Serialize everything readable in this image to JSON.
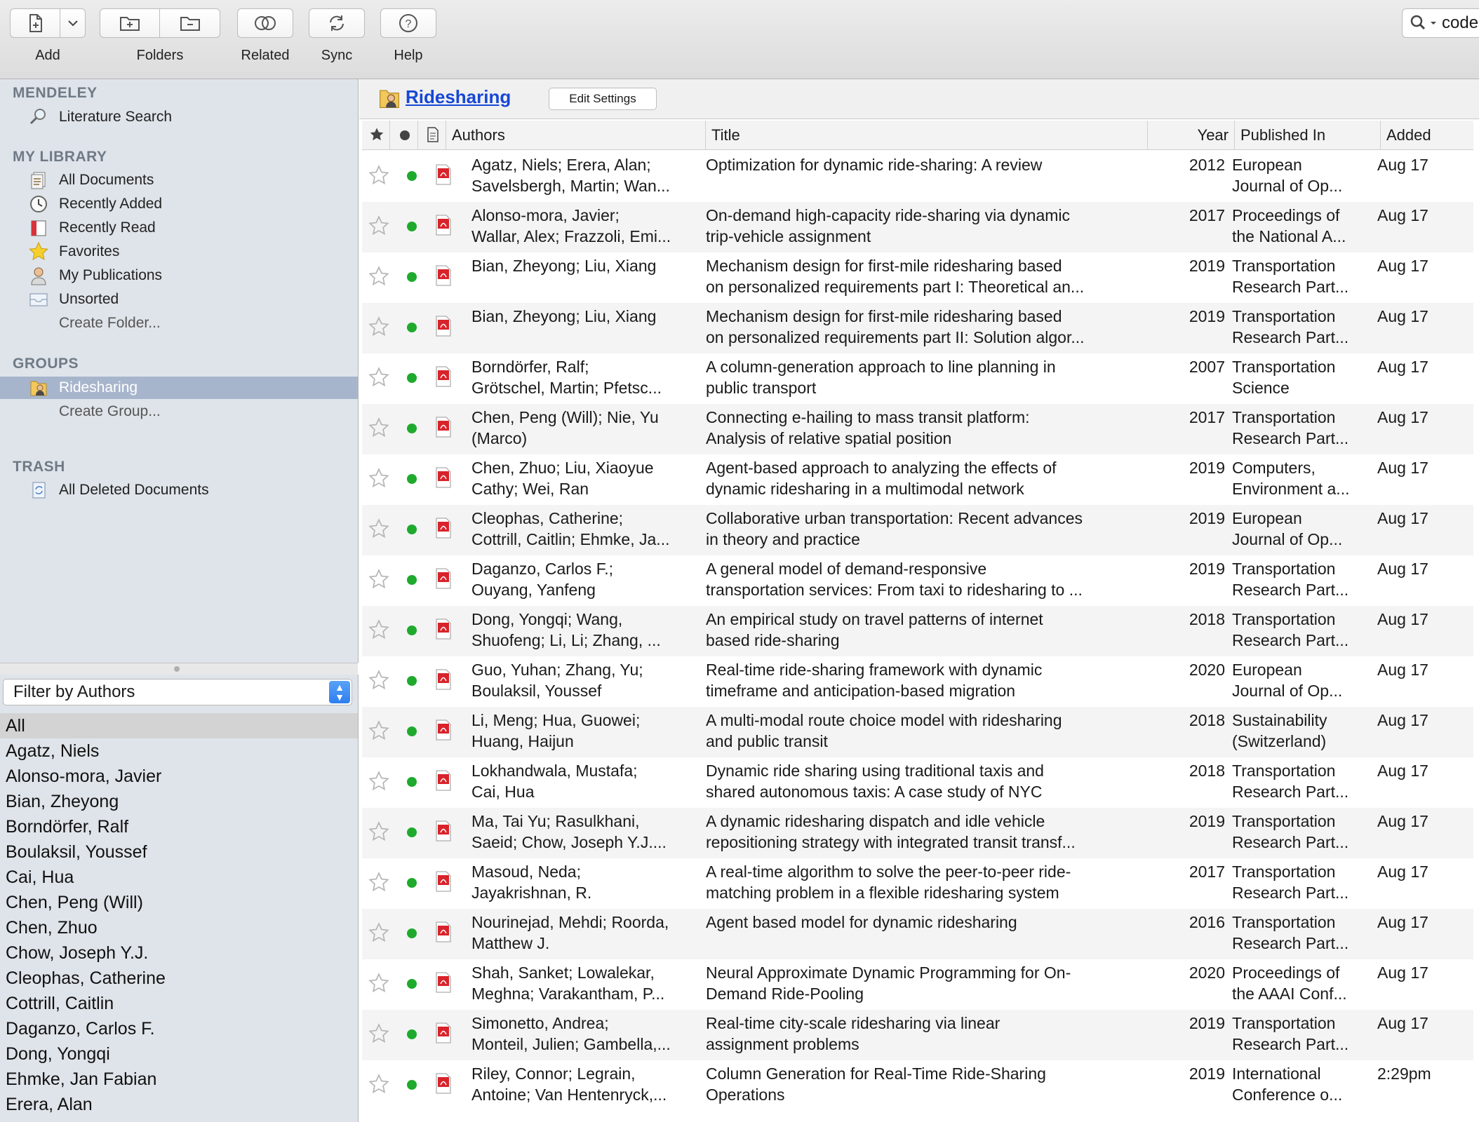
{
  "toolbar": {
    "add": "Add",
    "folders": "Folders",
    "related": "Related",
    "sync": "Sync",
    "help": "Help",
    "search_value": "code"
  },
  "sidebar": {
    "mendeley_header": "MENDELEY",
    "literature_search": "Literature Search",
    "library_header": "MY LIBRARY",
    "all_documents": "All Documents",
    "recently_added": "Recently Added",
    "recently_read": "Recently Read",
    "favorites": "Favorites",
    "my_publications": "My Publications",
    "unsorted": "Unsorted",
    "create_folder": "Create Folder...",
    "groups_header": "GROUPS",
    "ridesharing": "Ridesharing",
    "create_group": "Create Group...",
    "trash_header": "TRASH",
    "all_deleted": "All Deleted Documents"
  },
  "filter": {
    "select_label": "Filter by Authors",
    "authors": [
      "All",
      "Agatz, Niels",
      "Alonso-mora, Javier",
      "Bian, Zheyong",
      "Borndörfer, Ralf",
      "Boulaksil, Youssef",
      "Cai, Hua",
      "Chen, Peng (Will)",
      "Chen, Zhuo",
      "Chow, Joseph Y.J.",
      "Cleophas, Catherine",
      "Cottrill, Caitlin",
      "Daganzo, Carlos F.",
      "Dong, Yongqi",
      "Ehmke, Jan Fabian",
      "Erera, Alan"
    ]
  },
  "main": {
    "group_title": "Ridesharing",
    "edit_settings": "Edit Settings",
    "columns": {
      "authors": "Authors",
      "title": "Title",
      "year": "Year",
      "published_in": "Published In",
      "added": "Added"
    }
  },
  "documents": [
    {
      "authors": "Agatz, Niels; Erera, Alan;\nSavelsbergh, Martin; Wan...",
      "title": "Optimization for dynamic ride-sharing: A review",
      "year": "2012",
      "published": "European\nJournal of Op...",
      "added": "Aug 17"
    },
    {
      "authors": "Alonso-mora, Javier;\nWallar, Alex; Frazzoli, Emi...",
      "title": "On-demand high-capacity ride-sharing via dynamic\ntrip-vehicle assignment",
      "year": "2017",
      "published": "Proceedings of\nthe National A...",
      "added": "Aug 17"
    },
    {
      "authors": "Bian, Zheyong; Liu, Xiang",
      "title": "Mechanism design for first-mile ridesharing based\non personalized requirements part I: Theoretical an...",
      "year": "2019",
      "published": "Transportation\nResearch Part...",
      "added": "Aug 17"
    },
    {
      "authors": "Bian, Zheyong; Liu, Xiang",
      "title": "Mechanism design for first-mile ridesharing based\non personalized requirements part II: Solution algor...",
      "year": "2019",
      "published": "Transportation\nResearch Part...",
      "added": "Aug 17"
    },
    {
      "authors": "Borndörfer, Ralf;\nGrötschel, Martin; Pfetsc...",
      "title": "A column-generation approach to line planning in\npublic transport",
      "year": "2007",
      "published": "Transportation\nScience",
      "added": "Aug 17"
    },
    {
      "authors": "Chen, Peng (Will); Nie, Yu\n(Marco)",
      "title": "Connecting e-hailing to mass transit platform:\nAnalysis of relative spatial position",
      "year": "2017",
      "published": "Transportation\nResearch Part...",
      "added": "Aug 17"
    },
    {
      "authors": "Chen, Zhuo; Liu, Xiaoyue\nCathy; Wei, Ran",
      "title": "Agent-based approach to analyzing the effects of\ndynamic ridesharing in a multimodal network",
      "year": "2019",
      "published": "Computers,\nEnvironment a...",
      "added": "Aug 17"
    },
    {
      "authors": "Cleophas, Catherine;\nCottrill, Caitlin; Ehmke, Ja...",
      "title": "Collaborative urban transportation: Recent advances\nin theory and practice",
      "year": "2019",
      "published": "European\nJournal of Op...",
      "added": "Aug 17"
    },
    {
      "authors": "Daganzo, Carlos F.;\nOuyang, Yanfeng",
      "title": "A general model of demand-responsive\ntransportation services: From taxi to ridesharing to ...",
      "year": "2019",
      "published": "Transportation\nResearch Part...",
      "added": "Aug 17"
    },
    {
      "authors": "Dong, Yongqi; Wang,\nShuofeng; Li, Li; Zhang, ...",
      "title": "An empirical study on travel patterns of internet\nbased ride-sharing",
      "year": "2018",
      "published": "Transportation\nResearch Part...",
      "added": "Aug 17"
    },
    {
      "authors": "Guo, Yuhan; Zhang, Yu;\nBoulaksil, Youssef",
      "title": "Real-time ride-sharing framework with dynamic\ntimeframe and anticipation-based migration",
      "year": "2020",
      "published": "European\nJournal of Op...",
      "added": "Aug 17"
    },
    {
      "authors": "Li, Meng; Hua, Guowei;\nHuang, Haijun",
      "title": "A multi-modal route choice model with ridesharing\nand public transit",
      "year": "2018",
      "published": "Sustainability\n(Switzerland)",
      "added": "Aug 17"
    },
    {
      "authors": "Lokhandwala, Mustafa;\nCai, Hua",
      "title": "Dynamic ride sharing using traditional taxis and\nshared autonomous taxis: A case study of NYC",
      "year": "2018",
      "published": "Transportation\nResearch Part...",
      "added": "Aug 17"
    },
    {
      "authors": "Ma, Tai Yu; Rasulkhani,\nSaeid; Chow, Joseph Y.J....",
      "title": "A dynamic ridesharing dispatch and idle vehicle\nrepositioning strategy with integrated transit transf...",
      "year": "2019",
      "published": "Transportation\nResearch Part...",
      "added": "Aug 17"
    },
    {
      "authors": "Masoud, Neda;\nJayakrishnan, R.",
      "title": "A real-time algorithm to solve the peer-to-peer ride-\nmatching problem in a flexible ridesharing system",
      "year": "2017",
      "published": "Transportation\nResearch Part...",
      "added": "Aug 17"
    },
    {
      "authors": "Nourinejad, Mehdi; Roorda,\nMatthew J.",
      "title": "Agent based model for dynamic ridesharing",
      "year": "2016",
      "published": "Transportation\nResearch Part...",
      "added": "Aug 17"
    },
    {
      "authors": "Shah, Sanket; Lowalekar,\nMeghna; Varakantham, P...",
      "title": "Neural Approximate Dynamic Programming for On-\nDemand Ride-Pooling",
      "year": "2020",
      "published": "Proceedings of\nthe AAAI Conf...",
      "added": "Aug 17"
    },
    {
      "authors": "Simonetto, Andrea;\nMonteil, Julien; Gambella,...",
      "title": "Real-time city-scale ridesharing via linear\nassignment problems",
      "year": "2019",
      "published": "Transportation\nResearch Part...",
      "added": "Aug 17"
    },
    {
      "authors": "Riley, Connor; Legrain,\nAntoine; Van Hentenryck,...",
      "title": "Column Generation for Real-Time Ride-Sharing\nOperations",
      "year": "2019",
      "published": "International\nConference o...",
      "added": "2:29pm"
    }
  ]
}
